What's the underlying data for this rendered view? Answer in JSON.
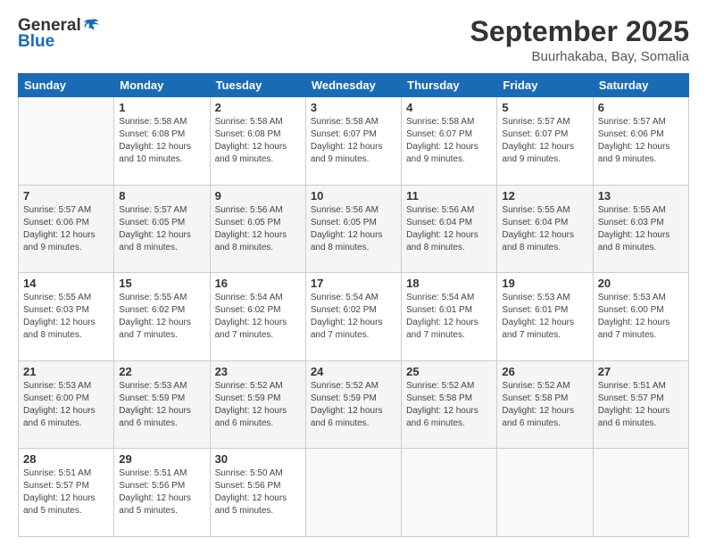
{
  "logo": {
    "line1": "General",
    "line2": "Blue",
    "icon": "▶"
  },
  "header": {
    "title": "September 2025",
    "subtitle": "Buurhakaba, Bay, Somalia"
  },
  "weekdays": [
    "Sunday",
    "Monday",
    "Tuesday",
    "Wednesday",
    "Thursday",
    "Friday",
    "Saturday"
  ],
  "days": [
    {
      "date": "",
      "info": ""
    },
    {
      "date": "1",
      "info": "Sunrise: 5:58 AM\nSunset: 6:08 PM\nDaylight: 12 hours\nand 10 minutes."
    },
    {
      "date": "2",
      "info": "Sunrise: 5:58 AM\nSunset: 6:08 PM\nDaylight: 12 hours\nand 9 minutes."
    },
    {
      "date": "3",
      "info": "Sunrise: 5:58 AM\nSunset: 6:07 PM\nDaylight: 12 hours\nand 9 minutes."
    },
    {
      "date": "4",
      "info": "Sunrise: 5:58 AM\nSunset: 6:07 PM\nDaylight: 12 hours\nand 9 minutes."
    },
    {
      "date": "5",
      "info": "Sunrise: 5:57 AM\nSunset: 6:07 PM\nDaylight: 12 hours\nand 9 minutes."
    },
    {
      "date": "6",
      "info": "Sunrise: 5:57 AM\nSunset: 6:06 PM\nDaylight: 12 hours\nand 9 minutes."
    },
    {
      "date": "7",
      "info": "Sunrise: 5:57 AM\nSunset: 6:06 PM\nDaylight: 12 hours\nand 9 minutes."
    },
    {
      "date": "8",
      "info": "Sunrise: 5:57 AM\nSunset: 6:05 PM\nDaylight: 12 hours\nand 8 minutes."
    },
    {
      "date": "9",
      "info": "Sunrise: 5:56 AM\nSunset: 6:05 PM\nDaylight: 12 hours\nand 8 minutes."
    },
    {
      "date": "10",
      "info": "Sunrise: 5:56 AM\nSunset: 6:05 PM\nDaylight: 12 hours\nand 8 minutes."
    },
    {
      "date": "11",
      "info": "Sunrise: 5:56 AM\nSunset: 6:04 PM\nDaylight: 12 hours\nand 8 minutes."
    },
    {
      "date": "12",
      "info": "Sunrise: 5:55 AM\nSunset: 6:04 PM\nDaylight: 12 hours\nand 8 minutes."
    },
    {
      "date": "13",
      "info": "Sunrise: 5:55 AM\nSunset: 6:03 PM\nDaylight: 12 hours\nand 8 minutes."
    },
    {
      "date": "14",
      "info": "Sunrise: 5:55 AM\nSunset: 6:03 PM\nDaylight: 12 hours\nand 8 minutes."
    },
    {
      "date": "15",
      "info": "Sunrise: 5:55 AM\nSunset: 6:02 PM\nDaylight: 12 hours\nand 7 minutes."
    },
    {
      "date": "16",
      "info": "Sunrise: 5:54 AM\nSunset: 6:02 PM\nDaylight: 12 hours\nand 7 minutes."
    },
    {
      "date": "17",
      "info": "Sunrise: 5:54 AM\nSunset: 6:02 PM\nDaylight: 12 hours\nand 7 minutes."
    },
    {
      "date": "18",
      "info": "Sunrise: 5:54 AM\nSunset: 6:01 PM\nDaylight: 12 hours\nand 7 minutes."
    },
    {
      "date": "19",
      "info": "Sunrise: 5:53 AM\nSunset: 6:01 PM\nDaylight: 12 hours\nand 7 minutes."
    },
    {
      "date": "20",
      "info": "Sunrise: 5:53 AM\nSunset: 6:00 PM\nDaylight: 12 hours\nand 7 minutes."
    },
    {
      "date": "21",
      "info": "Sunrise: 5:53 AM\nSunset: 6:00 PM\nDaylight: 12 hours\nand 6 minutes."
    },
    {
      "date": "22",
      "info": "Sunrise: 5:53 AM\nSunset: 5:59 PM\nDaylight: 12 hours\nand 6 minutes."
    },
    {
      "date": "23",
      "info": "Sunrise: 5:52 AM\nSunset: 5:59 PM\nDaylight: 12 hours\nand 6 minutes."
    },
    {
      "date": "24",
      "info": "Sunrise: 5:52 AM\nSunset: 5:59 PM\nDaylight: 12 hours\nand 6 minutes."
    },
    {
      "date": "25",
      "info": "Sunrise: 5:52 AM\nSunset: 5:58 PM\nDaylight: 12 hours\nand 6 minutes."
    },
    {
      "date": "26",
      "info": "Sunrise: 5:52 AM\nSunset: 5:58 PM\nDaylight: 12 hours\nand 6 minutes."
    },
    {
      "date": "27",
      "info": "Sunrise: 5:51 AM\nSunset: 5:57 PM\nDaylight: 12 hours\nand 6 minutes."
    },
    {
      "date": "28",
      "info": "Sunrise: 5:51 AM\nSunset: 5:57 PM\nDaylight: 12 hours\nand 5 minutes."
    },
    {
      "date": "29",
      "info": "Sunrise: 5:51 AM\nSunset: 5:56 PM\nDaylight: 12 hours\nand 5 minutes."
    },
    {
      "date": "30",
      "info": "Sunrise: 5:50 AM\nSunset: 5:56 PM\nDaylight: 12 hours\nand 5 minutes."
    },
    {
      "date": "",
      "info": ""
    },
    {
      "date": "",
      "info": ""
    },
    {
      "date": "",
      "info": ""
    },
    {
      "date": "",
      "info": ""
    }
  ]
}
